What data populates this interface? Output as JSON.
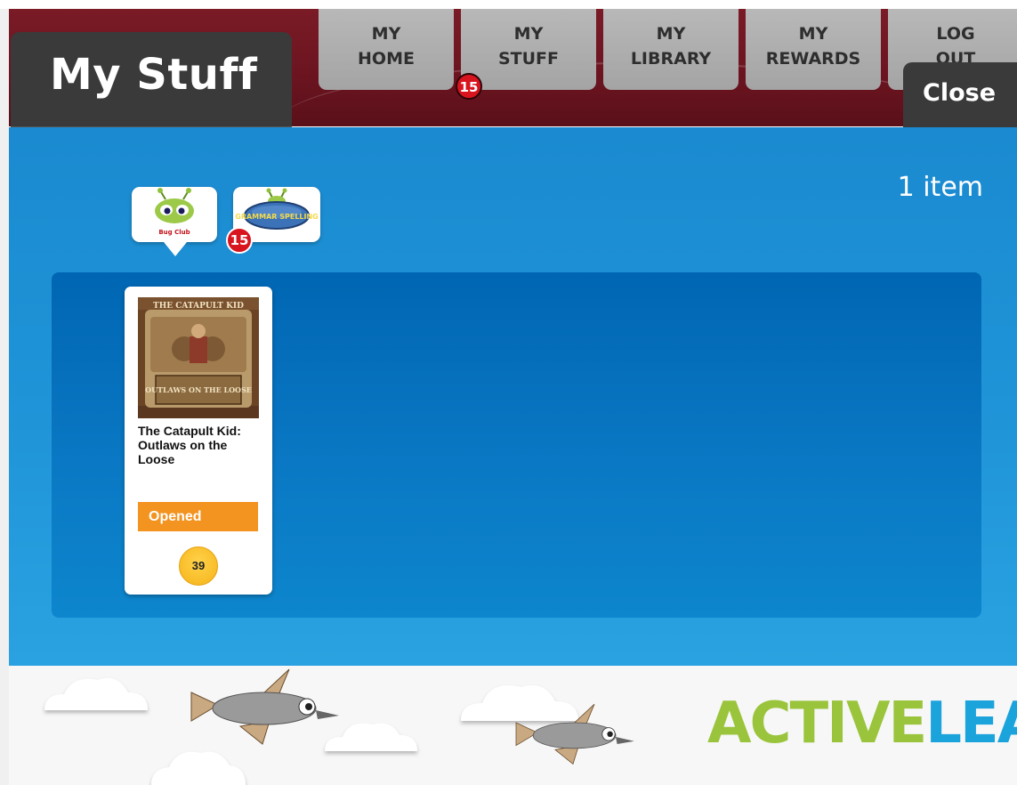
{
  "header": {
    "page_title": "My Stuff",
    "close_label": "Close"
  },
  "nav": {
    "tabs": [
      {
        "label": "MY\nHOME"
      },
      {
        "label": "MY\nSTUFF"
      },
      {
        "label": "MY\nLIBRARY"
      },
      {
        "label": "MY\nREWARDS"
      },
      {
        "label": "LOG\nOUT"
      }
    ],
    "badge": "15"
  },
  "filters": {
    "item_count": "1 item",
    "items": [
      {
        "name": "bug-club",
        "label": "Bug Club",
        "selected": true
      },
      {
        "name": "grammar-spelling",
        "label": "GRAMMAR SPELLING",
        "selected": false,
        "badge": "15"
      }
    ]
  },
  "books": [
    {
      "title": "The Catapult Kid: Outlaws on the Loose",
      "cover_text_top": "THE CATAPULT KID",
      "cover_text_bottom": "OUTLAWS ON THE LOOSE",
      "status": "Opened",
      "points": "39"
    }
  ],
  "footer": {
    "logo_part1": "ACTIVE",
    "logo_part2": "LEARN"
  },
  "colors": {
    "header": "#6a1420",
    "main_blue": "#1f95d8",
    "panel_blue": "#0a78c4",
    "status_orange": "#f39320",
    "coin_gold": "#f6b319",
    "logo_green": "#9ac43c",
    "logo_blue": "#1ba3dc"
  }
}
